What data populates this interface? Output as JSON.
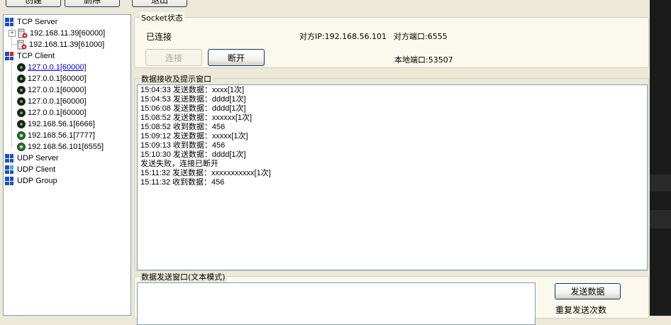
{
  "toolbar": {
    "create_label": "创建",
    "delete_label": "删除",
    "exit_label": "退出"
  },
  "tree": {
    "tcp_server": {
      "label": "TCP Server",
      "items": [
        "192.168.11.39[60000]",
        "192.168.11.39[61000]"
      ]
    },
    "tcp_client": {
      "label": "TCP Client",
      "items": [
        "127.0.0.1[60000]",
        "127.0.0.1[60000]",
        "127.0.0.1[60000]",
        "127.0.0.1[60000]",
        "127.0.0.1[60000]",
        "192.168.56.1[6666]",
        "192.168.56.1[7777]",
        "192.168.56.101[6555]"
      ]
    },
    "udp_server": {
      "label": "UDP Server"
    },
    "udp_client": {
      "label": "UDP Client"
    },
    "udp_group": {
      "label": "UDP Group"
    }
  },
  "socket": {
    "legend": "Socket状态",
    "status": "已连接",
    "remote_ip": "对方IP:192.168.56.101",
    "remote_port": "对方端口:6555",
    "local_port": "本地端口:53507",
    "connect_label": "连接",
    "disconnect_label": "断开"
  },
  "receive": {
    "legend": "数据接收及提示窗口",
    "lines": [
      "15:04:33 发送数据：xxxx[1次]",
      "15:04:53 发送数据：dddd[1次]",
      "15:06:08 发送数据：dddd[1次]",
      "15:08:52 发送数据：xxxxxx[1次]",
      "15:08:52 收到数据：456",
      "15:09:12 发送数据：xxxxx[1次]",
      "15:09:13 收到数据：456",
      "15:10:30 发送数据：dddd[1次]",
      "发送失败，连接已断开",
      "15:11:32 发送数据：xxxxxxxxxxx[1次]",
      "15:11:32 收到数据：456"
    ]
  },
  "send": {
    "legend": "数据发送窗口(文本模式)",
    "text": "",
    "send_label": "发送数据",
    "repeat_label": "重复发送次数"
  },
  "colors": {
    "window_bg": "#ece9d8",
    "tree_border": "#7f9db9",
    "link": "#0000cc",
    "icon_blue": "#1c4fc4",
    "icon_red": "#d42020",
    "icon_green": "#3cd23c"
  }
}
